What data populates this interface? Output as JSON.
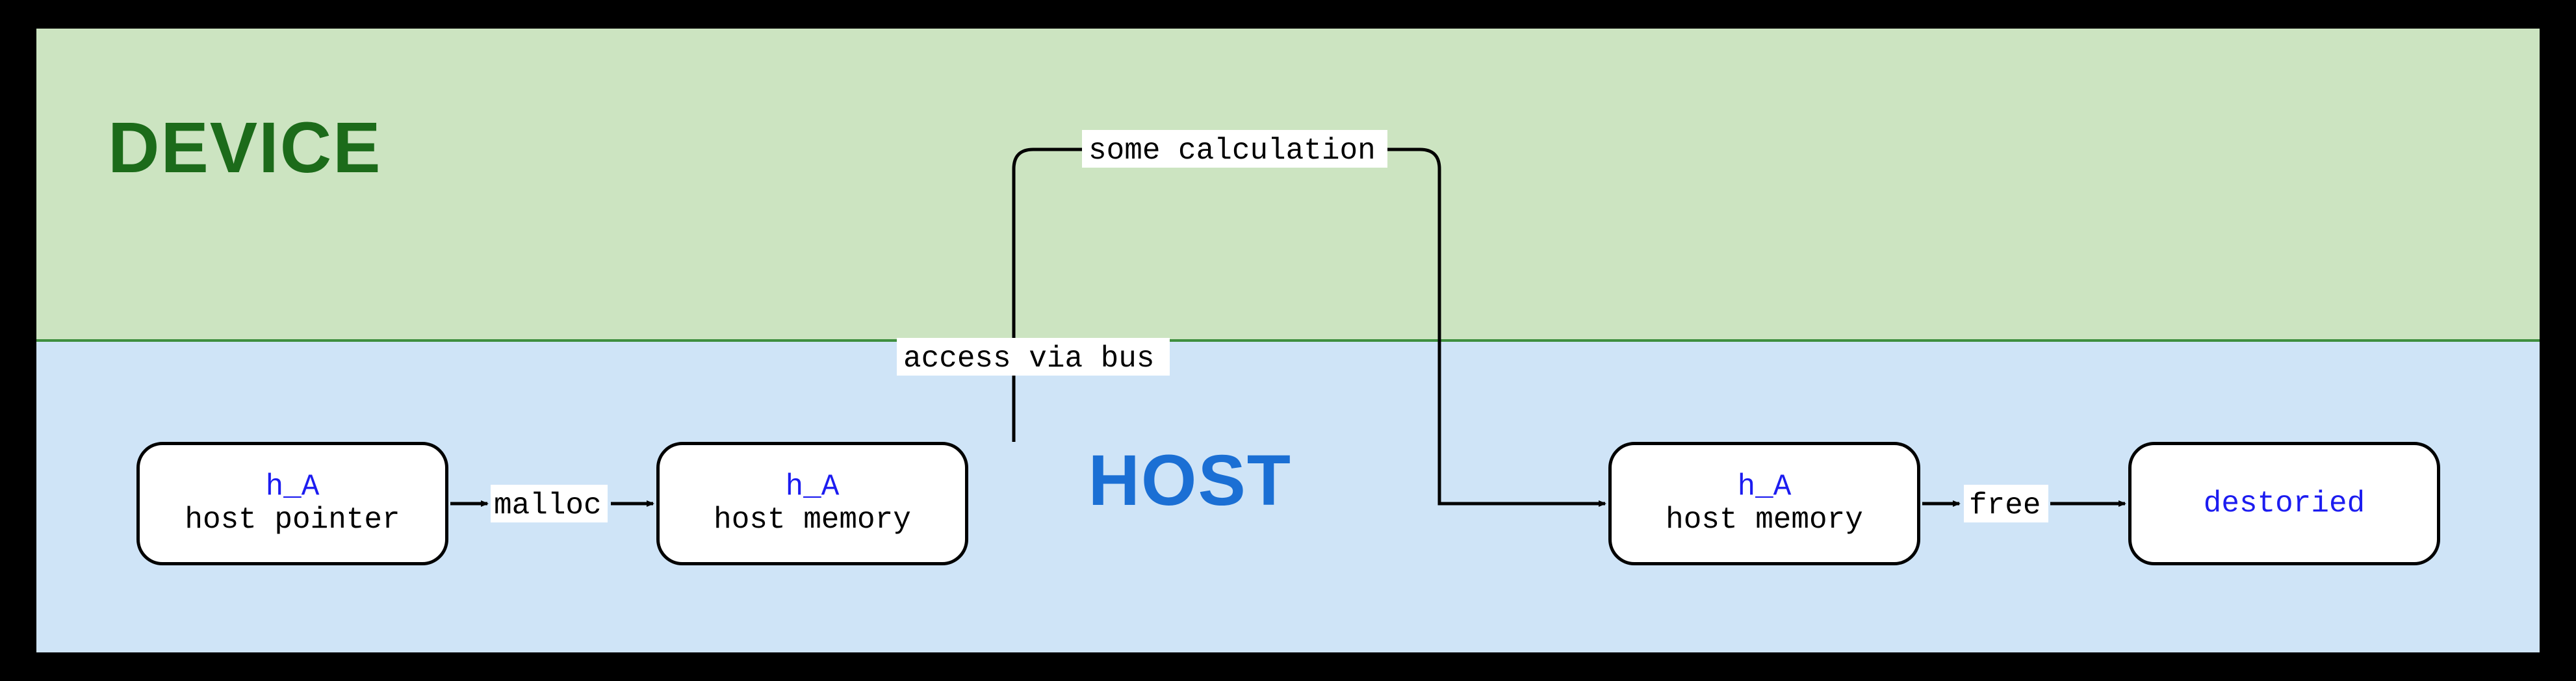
{
  "regions": {
    "device_title": "DEVICE",
    "host_title": "HOST"
  },
  "nodes": {
    "n1": {
      "var": "h_A",
      "sub": "host pointer"
    },
    "n2": {
      "var": "h_A",
      "sub": "host memory"
    },
    "n3": {
      "var": "h_A",
      "sub": "host memory"
    },
    "n4": {
      "var": "destoried",
      "sub": ""
    }
  },
  "edges": {
    "e1": "malloc",
    "e2": "access via bus",
    "e3": "some calculation",
    "e4": "free"
  }
}
